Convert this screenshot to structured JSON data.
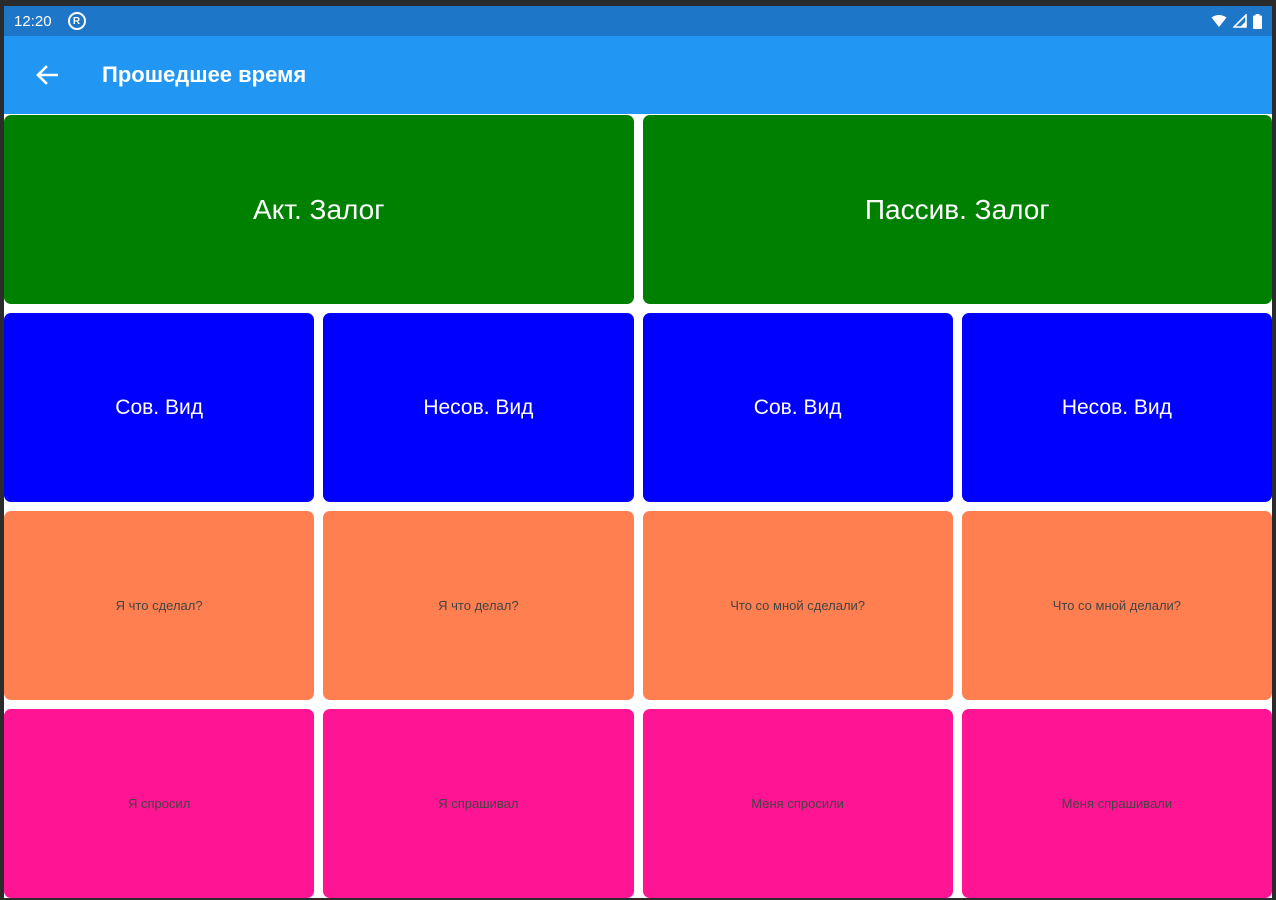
{
  "status_bar": {
    "time": "12:20"
  },
  "app_bar": {
    "title": "Прошедшее время"
  },
  "colors": {
    "status_bar": "#1e76c8",
    "app_bar": "#2196f3",
    "voice_tile": "#008000",
    "aspect_tile": "#0000ff",
    "question_tile": "#ff7f50",
    "example_tile": "#ff1493"
  },
  "voice": [
    {
      "label": "Акт. Залог"
    },
    {
      "label": "Пассив. Залог"
    }
  ],
  "aspect": [
    {
      "label": "Сов. Вид"
    },
    {
      "label": "Несов. Вид"
    },
    {
      "label": "Сов. Вид"
    },
    {
      "label": "Несов. Вид"
    }
  ],
  "questions": [
    {
      "label": "Я что сделал?"
    },
    {
      "label": "Я что делал?"
    },
    {
      "label": "Что со мной сделали?"
    },
    {
      "label": "Что со мной делали?"
    }
  ],
  "examples": [
    {
      "label": "Я спросил"
    },
    {
      "label": "Я спрашивал"
    },
    {
      "label": "Меня спросили"
    },
    {
      "label": "Меня спрашивали"
    }
  ]
}
